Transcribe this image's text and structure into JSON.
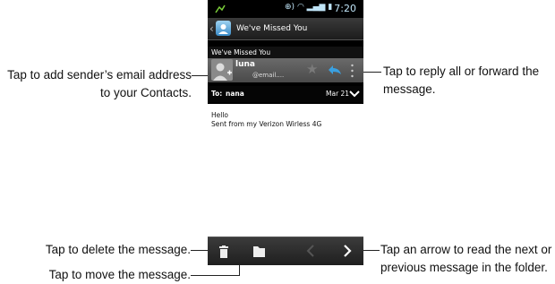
{
  "status": {
    "time": "7:20"
  },
  "email": {
    "title": "We've Missed You",
    "subject": "We've Missed You",
    "sender_name": "luna",
    "sender_email": "@email....",
    "to_label": "To:",
    "to_name": "nana",
    "date": "Mar 21",
    "body_lines": [
      "Hello",
      "Sent from my Verizon Wirless 4G"
    ]
  },
  "callouts": {
    "add_sender_1": "Tap to add sender’s email address",
    "add_sender_2": "to your Contacts.",
    "reply_1": "Tap to reply all or forward the",
    "reply_2": "message.",
    "delete": "Tap to delete the message.",
    "move": "Tap to move the message.",
    "arrow_1": "Tap an arrow to read the next or",
    "arrow_2": "previous message in the folder."
  },
  "icons": {
    "menu": "overflow-menu-icon",
    "star": "star-icon",
    "reply": "reply-icon",
    "delete": "trash-icon",
    "move": "folder-icon",
    "prev": "chevron-left-icon",
    "next": "chevron-right-icon"
  },
  "colors": {
    "accent_blue": "#3aa0e0",
    "status_blue": "#bfe4f7"
  }
}
